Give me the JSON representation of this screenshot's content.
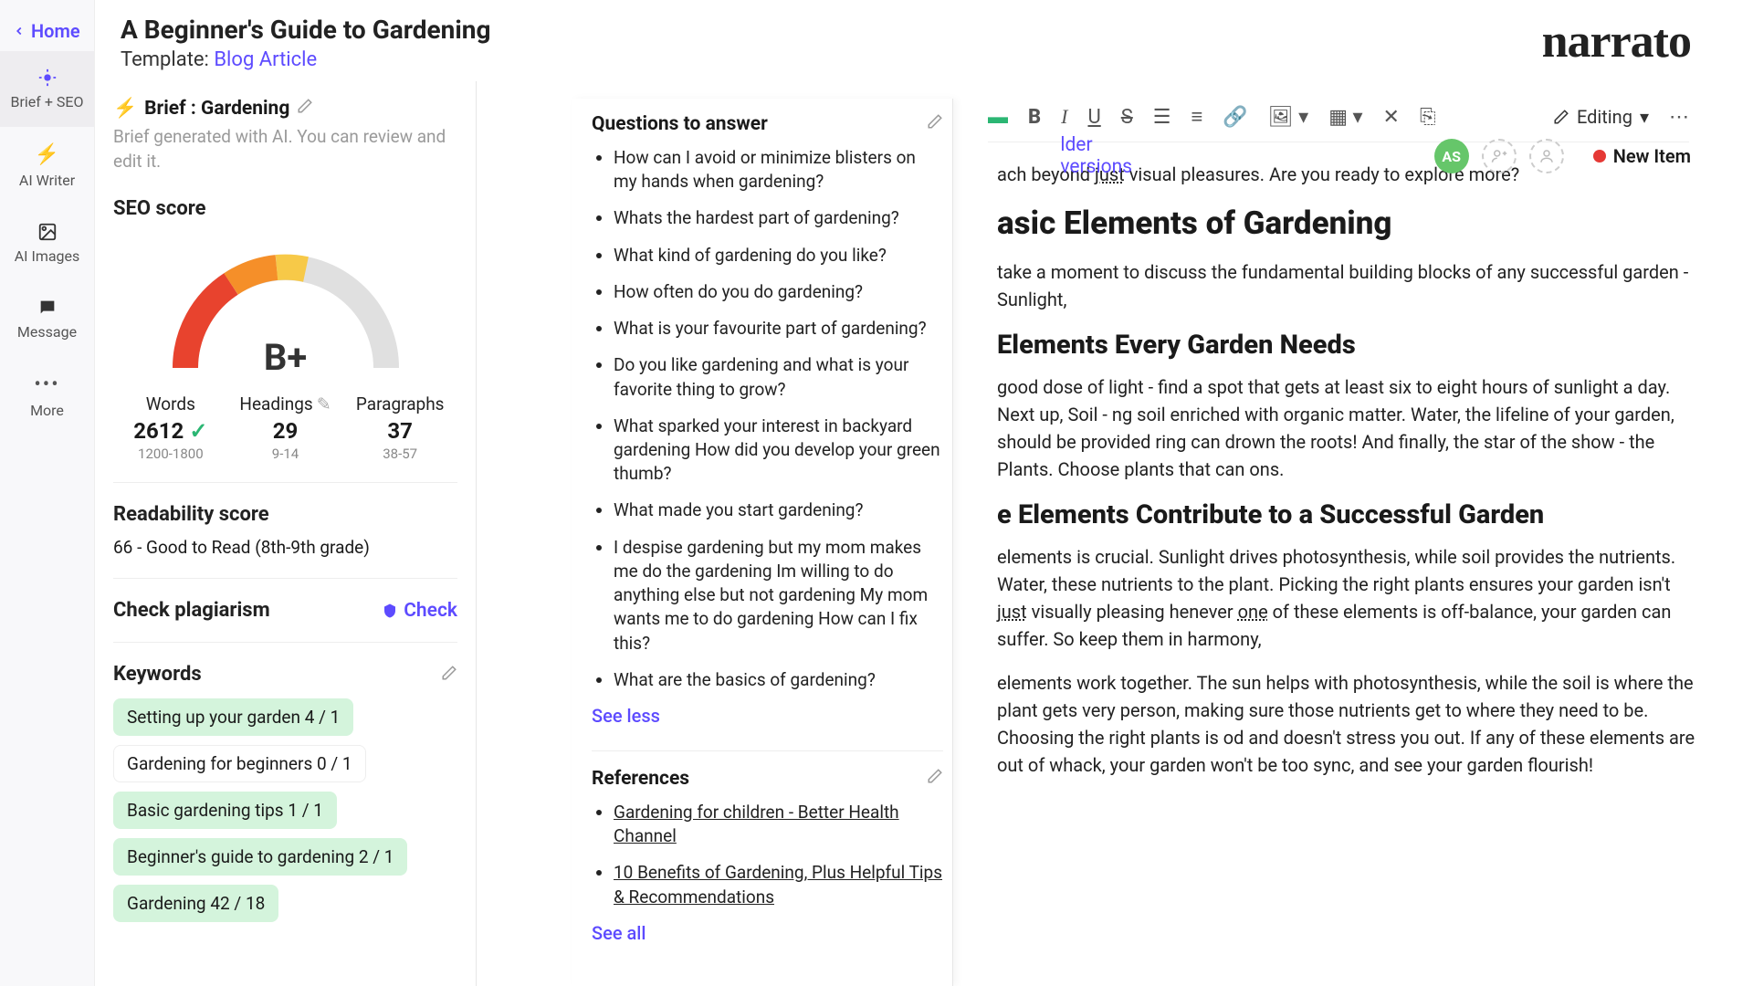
{
  "nav": {
    "home": "Home",
    "items": [
      {
        "label": "Brief + SEO",
        "active": true
      },
      {
        "label": "AI Writer"
      },
      {
        "label": "AI Images"
      },
      {
        "label": "Message"
      },
      {
        "label": "More"
      }
    ]
  },
  "title": "A Beginner's Guide to Gardening",
  "template_prefix": "Template: ",
  "template_link": "Blog Article",
  "logo": "narrato",
  "older_versions": "lder versions",
  "avatar": "AS",
  "status": "New Item",
  "seo": {
    "brief_label": "Brief : Gardening",
    "brief_sub": "Brief generated with AI. You can review and edit it.",
    "score_heading": "SEO score",
    "grade": "B+",
    "metrics": [
      {
        "label": "Words",
        "value": "2612",
        "range": "1200-1800",
        "check": true
      },
      {
        "label": "Headings",
        "value": "29",
        "range": "9-14",
        "check": false,
        "edit": true
      },
      {
        "label": "Paragraphs",
        "value": "37",
        "range": "38-57",
        "check": false
      }
    ],
    "readability_heading": "Readability score",
    "readability_text": "66 - Good to Read (8th-9th grade)",
    "plagiarism_heading": "Check plagiarism",
    "check_label": "Check",
    "keywords_heading": "Keywords",
    "keywords": [
      {
        "text": "Setting up your garden  4 / 1",
        "good": true
      },
      {
        "text": "Gardening for beginners  0 / 1",
        "good": false
      },
      {
        "text": "Basic gardening tips  1 / 1",
        "good": true
      },
      {
        "text": "Beginner's guide to gardening  2 / 1",
        "good": true
      },
      {
        "text": "Gardening  42 / 18",
        "good": true
      }
    ]
  },
  "questions": {
    "heading": "Questions to answer",
    "items": [
      "How can I avoid or minimize blisters on my hands when gardening?",
      "Whats the hardest part of gardening?",
      "What kind of gardening do you like?",
      "How often do you do gardening?",
      "What is your favourite part of gardening?",
      "Do you like gardening and what is your favorite thing to grow?",
      "What sparked your interest in backyard gardening How did you develop your green thumb?",
      "What made you start gardening?",
      "I despise gardening but my mom makes me do the gardening Im willing to do anything else but not gardening My mom wants me to do gardening How can I fix this?",
      "What are the basics of gardening?"
    ],
    "see_less": "See less"
  },
  "references": {
    "heading": "References",
    "items": [
      "Gardening for children - Better Health Channel",
      "10 Benefits of Gardening, Plus Helpful Tips & Recommendations"
    ],
    "see_all": "See all"
  },
  "toolbar": {
    "editing": "Editing"
  },
  "doc": {
    "p1_prefix": "ach beyond ",
    "p1_u": "just",
    "p1_suffix": " visual pleasures. Are you ready to explore more?",
    "h2a": "asic Elements of Gardening",
    "p2": " take a moment to discuss the fundamental building blocks of any successful garden - Sunlight,",
    "h3a": "Elements Every Garden Needs",
    "p3": "good dose of light - find a spot that gets at least six to eight hours of sunlight a day. Next up, Soil - ng soil enriched with organic matter. Water, the lifeline of your garden, should be provided ring can drown the roots! And finally, the star of the show - the Plants. Choose plants that can ons.",
    "h3b": "e Elements Contribute to a Successful Garden",
    "p4_prefix": " elements is crucial. Sunlight drives photosynthesis, while soil provides the nutrients. Water,  these nutrients to the plant. Picking the right plants ensures your garden isn't ",
    "p4_u1": "just",
    "p4_mid": " visually pleasing henever ",
    "p4_u2": "one",
    "p4_suffix": " of these elements is off-balance, your garden can suffer. So keep them in harmony,",
    "p5": " elements work together. The sun helps with photosynthesis, while the soil is where the plant gets very person, making sure those nutrients get to where they need to be. Choosing the right plants is od and doesn't stress you out. If any of these elements are out of whack, your garden won't be too  sync, and see your garden flourish!"
  }
}
